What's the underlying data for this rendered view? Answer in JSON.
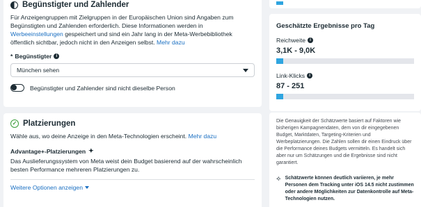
{
  "beneficiary": {
    "title": "Begünstigter und Zahlender",
    "text": "Für Anzeigengruppen mit Zielgruppen in der Europäischen Union sind Angaben zum Begünstigten und Zahlenden erforderlich. Diese Informationen werden in ",
    "link_settings": "Werbeeinstellungen",
    "text2": " gespeichert und sind ein Jahr lang in der Meta-Werbebibliothek öffentlich sichtbar, jedoch nicht in den Anzeigen selbst. ",
    "link_more": "Mehr dazu",
    "field_label": "Begünstigter",
    "field_required": "*",
    "field_value": "München sehen",
    "toggle_label": "Begünstigter und Zahlender sind nicht dieselbe Person"
  },
  "placements": {
    "title": "Platzierungen",
    "text": "Wähle aus, wo deine Anzeige in den Meta-Technologien erscheint. ",
    "link_more": "Mehr dazu",
    "advantage_title": "Advantage+-Platzierungen",
    "advantage_text": "Das Auslieferungssystem von Meta weist dein Budget basierend auf der wahrscheinlich besten Performance mehreren Platzierungen zu.",
    "more_options": "Weitere Optionen anzeigen"
  },
  "estimates": {
    "title": "Geschätzte Ergebnisse pro Tag",
    "reach_label": "Reichweite",
    "reach_value": "3,1K - 9,0K",
    "reach_fill": 0.05,
    "clicks_label": "Link-Klicks",
    "clicks_value": "87 - 251",
    "clicks_fill": 0.05
  },
  "disclaimer": {
    "text": "Die Genauigkeit der Schätzwerte basiert auf Faktoren wie bisherigen Kampagnendaten, dem von dir eingegebenen Budget, Marktdaten, Targeting-Kriterien und Werbeplatzierungen. Die Zahlen sollen dir einen Eindruck über die Performance deines Budgets vermitteln. Es handelt sich aber nur um Schätzungen und die Ergebnisse sind nicht garantiert.",
    "warning": "Schätzwerte können deutlich variieren, je mehr Personen dem Tracking unter iOS 14.5 nicht zustimmen oder andere Möglichkeiten zur Datenkontrolle auf Meta-Technologien nutzen."
  }
}
